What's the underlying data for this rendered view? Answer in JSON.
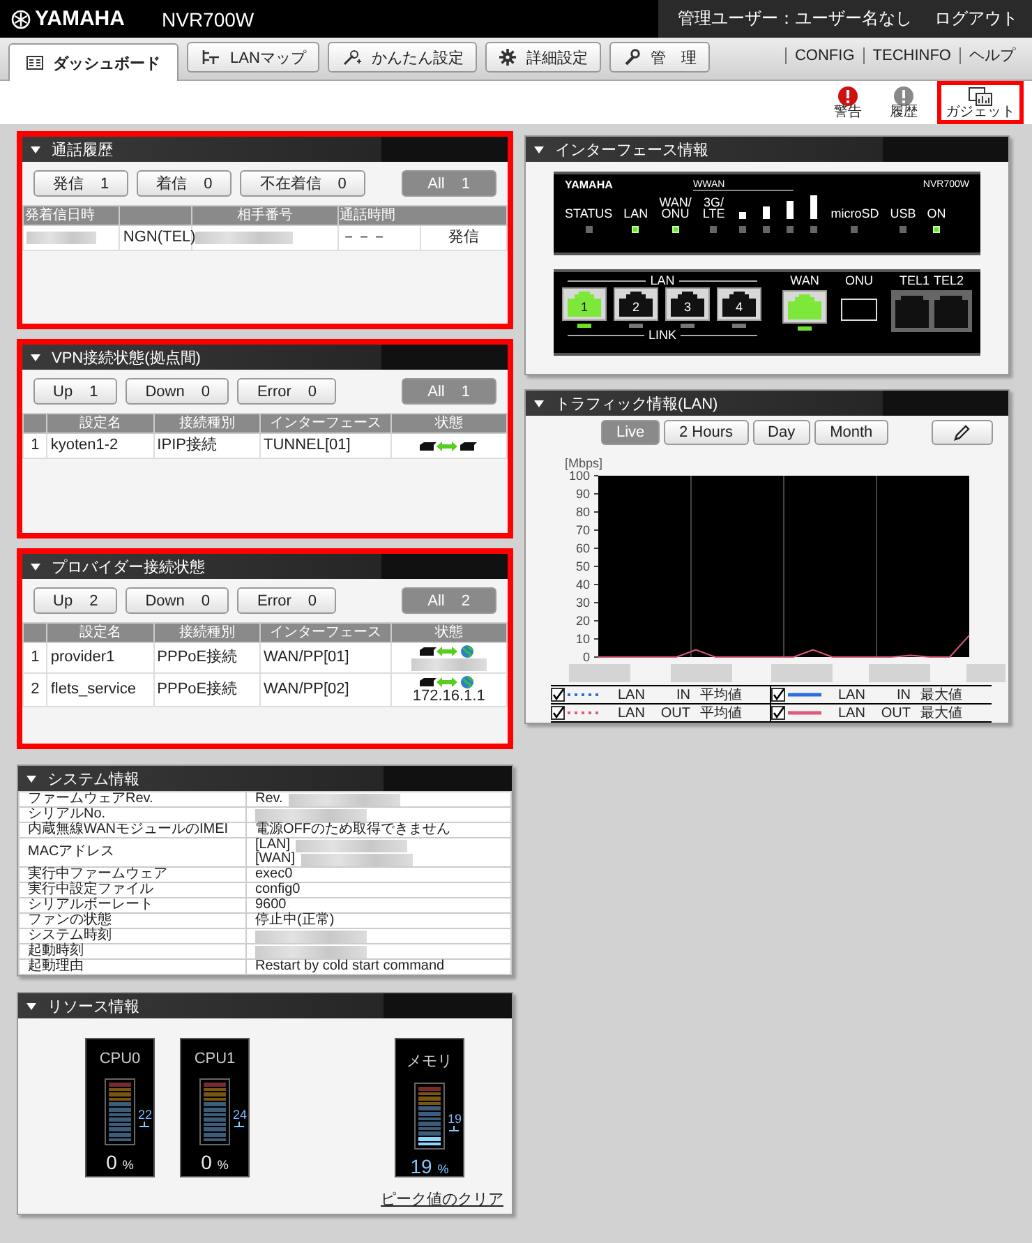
{
  "header": {
    "logo": "YAMAHA",
    "model": "NVR700W",
    "user": "管理ユーザー：ユーザー名なし",
    "logout": "ログアウト"
  },
  "tabs": [
    {
      "label": "ダッシュボード",
      "selected": true
    },
    {
      "label": "LANマップ",
      "selected": false
    },
    {
      "label": "かんたん設定",
      "selected": false
    },
    {
      "label": "詳細設定",
      "selected": false
    },
    {
      "label": "管　理",
      "selected": false
    }
  ],
  "links": [
    "CONFIG",
    "TECHINFO",
    "ヘルプ"
  ],
  "tools": [
    {
      "label": "警告",
      "highlighted": false
    },
    {
      "label": "履歴",
      "highlighted": false
    },
    {
      "label": "ガジェット",
      "highlighted": true
    }
  ],
  "call_history": {
    "title": "通話履歴",
    "highlighted": true,
    "filters": [
      {
        "label": "発信",
        "count": "1"
      },
      {
        "label": "着信",
        "count": "0"
      },
      {
        "label": "不在着信",
        "count": "0"
      }
    ],
    "all": {
      "label": "All",
      "count": "1"
    },
    "columns": [
      "発着信日時",
      "相手番号",
      "通話時間"
    ],
    "rows": [
      {
        "line": "NGN(TEL)",
        "duration": "－－－",
        "direction": "発信"
      }
    ]
  },
  "vpn": {
    "title": "VPN接続状態(拠点間)",
    "highlighted": true,
    "filters": [
      {
        "label": "Up",
        "count": "1"
      },
      {
        "label": "Down",
        "count": "0"
      },
      {
        "label": "Error",
        "count": "0"
      }
    ],
    "all": {
      "label": "All",
      "count": "1"
    },
    "columns": [
      "設定名",
      "接続種別",
      "インターフェース",
      "状態"
    ],
    "rows": [
      {
        "no": "1",
        "name": "kyoten1-2",
        "type": "IPIP接続",
        "interface": "TUNNEL[01]",
        "kind": "tunnel",
        "up": true
      }
    ]
  },
  "provider": {
    "title": "プロバイダー接続状態",
    "highlighted": true,
    "filters": [
      {
        "label": "Up",
        "count": "2"
      },
      {
        "label": "Down",
        "count": "0"
      },
      {
        "label": "Error",
        "count": "0"
      }
    ],
    "all": {
      "label": "All",
      "count": "2"
    },
    "columns": [
      "設定名",
      "接続種別",
      "インターフェース",
      "状態"
    ],
    "rows": [
      {
        "no": "1",
        "name": "provider1",
        "type": "PPPoE接続",
        "interface": "WAN/PP[01]",
        "kind": "internet",
        "up": true
      },
      {
        "no": "2",
        "name": "flets_service",
        "type": "PPPoE接続",
        "interface": "WAN/PP[02]",
        "kind": "internet",
        "up": true,
        "address": "172.16.1.1"
      }
    ]
  },
  "system": {
    "title": "システム情報",
    "highlighted": false,
    "rows": [
      {
        "label": "ファームウェアRev.",
        "lines": [
          {
            "text": "Rev.",
            "blurred": true
          }
        ]
      },
      {
        "label": "シリアルNo.",
        "lines": [
          {
            "blurred": true
          }
        ]
      },
      {
        "label": "内蔵無線WANモジュールのIMEI",
        "lines": [
          {
            "text": "電源OFFのため取得できません",
            "blurred": false
          }
        ]
      },
      {
        "label": "MACアドレス",
        "lines": [
          {
            "text": "[LAN]",
            "blurred": true
          },
          {
            "text": "[WAN]",
            "blurred": true
          }
        ]
      },
      {
        "label": "実行中ファームウェア",
        "lines": [
          {
            "text": "exec0",
            "blurred": false
          }
        ]
      },
      {
        "label": "実行中設定ファイル",
        "lines": [
          {
            "text": "config0",
            "blurred": false
          }
        ]
      },
      {
        "label": "シリアルボーレート",
        "lines": [
          {
            "text": "9600",
            "blurred": false
          }
        ]
      },
      {
        "label": "ファンの状態",
        "lines": [
          {
            "text": "停止中(正常)",
            "blurred": false
          }
        ]
      },
      {
        "label": "システム時刻",
        "lines": [
          {
            "blurred": true
          }
        ]
      },
      {
        "label": "起動時刻",
        "lines": [
          {
            "blurred": true
          }
        ]
      },
      {
        "label": "起動理由",
        "lines": [
          {
            "text": "Restart by cold start command",
            "blurred": false
          }
        ]
      }
    ]
  },
  "resources": {
    "title": "リソース情報",
    "highlighted": false,
    "meters": [
      {
        "label": "CPU0",
        "level": 0,
        "reading": "0",
        "unit": "%",
        "peak": "22"
      },
      {
        "label": "CPU1",
        "level": 0,
        "reading": "0",
        "unit": "%",
        "peak": "24"
      },
      {
        "label": "メモリ",
        "level": 0.19,
        "reading": "19",
        "unit": "%",
        "peak": "19"
      }
    ],
    "clear_link": "ピーク値のクリア"
  },
  "interface": {
    "title": "インターフェース情報",
    "highlighted": false,
    "front": {
      "logo": "YAMAHA",
      "wwan": "WWAN",
      "model": "NVR700W",
      "leds": [
        {
          "label": "STATUS",
          "on": false
        },
        {
          "label": "LAN",
          "on": true
        },
        {
          "label": "WAN/\nONU",
          "on": true
        },
        {
          "label": "3G/\nLTE",
          "on": false
        }
      ],
      "signal": [
        {
          "on": false
        },
        {
          "on": false
        },
        {
          "on": false
        },
        {
          "on": false
        }
      ],
      "leds_right": [
        {
          "label": "microSD",
          "on": false
        },
        {
          "label": "USB",
          "on": false
        },
        {
          "label": "ON",
          "on": true
        }
      ]
    },
    "back": {
      "lan_label": "LAN",
      "link_label": "LINK",
      "ports": [
        {
          "label": "1",
          "link": true
        },
        {
          "label": "2",
          "link": false
        },
        {
          "label": "3",
          "link": false
        },
        {
          "label": "4",
          "link": false
        }
      ],
      "wan": {
        "label": "WAN",
        "link": true
      },
      "onu": "ONU",
      "tel": [
        "TEL1",
        "TEL2"
      ]
    }
  },
  "traffic": {
    "title": "トラフィック情報(LAN)",
    "highlighted": false,
    "ranges": [
      {
        "label": "Live",
        "selected": true
      },
      {
        "label": "2 Hours",
        "selected": false
      },
      {
        "label": "Day",
        "selected": false
      },
      {
        "label": "Month",
        "selected": false
      }
    ],
    "chart_data": {
      "type": "line",
      "ylabel": "[Mbps]",
      "ylim": [
        0,
        100
      ],
      "yticks": [
        0,
        10,
        20,
        30,
        40,
        50,
        60,
        70,
        80,
        90,
        100
      ],
      "series": [
        {
          "color": "#e05a78",
          "values": [
            0,
            0,
            0,
            0,
            0,
            4,
            0,
            0,
            0,
            0,
            0,
            4,
            0,
            0,
            0,
            0,
            1,
            0,
            0,
            12
          ]
        }
      ]
    },
    "legend": [
      {
        "checked": true,
        "kind": "dotted",
        "color": "#2a6ee0",
        "labels": [
          "LAN",
          "IN",
          "平均値"
        ]
      },
      {
        "checked": true,
        "kind": "solid",
        "color": "#2a6ee0",
        "labels": [
          "LAN",
          "IN",
          "最大値"
        ]
      },
      {
        "checked": true,
        "kind": "dotted",
        "color": "#e05a78",
        "labels": [
          "LAN",
          "OUT",
          "平均値"
        ]
      },
      {
        "checked": true,
        "kind": "solid",
        "color": "#e05a78",
        "labels": [
          "LAN",
          "OUT",
          "最大値"
        ]
      }
    ]
  }
}
